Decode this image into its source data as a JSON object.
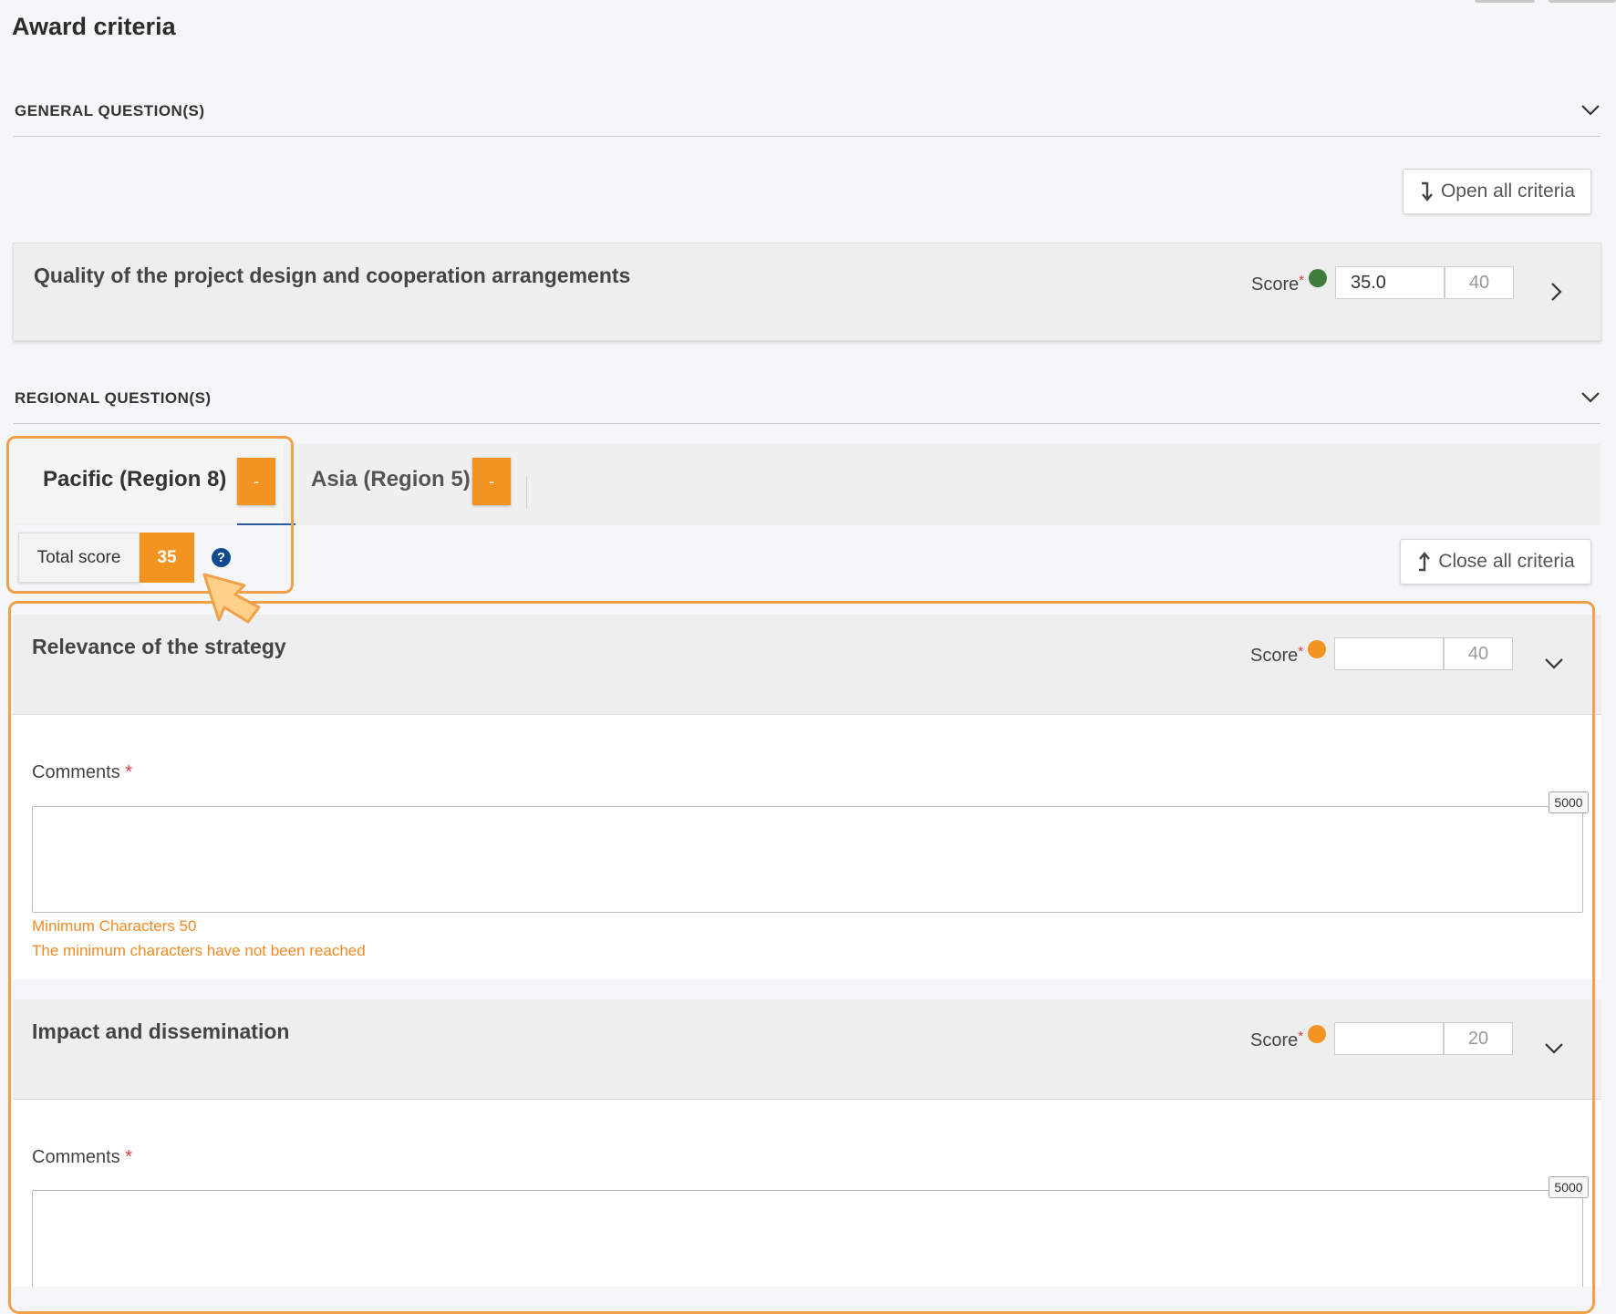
{
  "page": {
    "title": "Award criteria"
  },
  "general": {
    "header": "GENERAL QUESTION(S)",
    "open_all_label": "Open all criteria",
    "criterion": {
      "title": "Quality of the project design and cooperation arrangements",
      "score_label": "Score",
      "required_mark": "*",
      "score_value": "35.0",
      "max_score": "40",
      "status_color": "#3f7d3c"
    }
  },
  "regional": {
    "header": "REGIONAL QUESTION(S)",
    "tabs": [
      {
        "label": "Pacific (Region 8)",
        "badge": "-"
      },
      {
        "label": "Asia (Region 5)",
        "badge": "-"
      }
    ],
    "total_score_label": "Total score",
    "total_score_value": "35",
    "help_icon": "?",
    "close_all_label": "Close all criteria",
    "criteria": [
      {
        "title": "Relevance of the strategy",
        "score_label": "Score",
        "required_mark": "*",
        "score_value": "",
        "max_score": "40",
        "status_color": "#f39322",
        "comments_label": "Comments",
        "comments_required": "*",
        "char_limit": "5000",
        "min_chars": "Minimum Characters 50",
        "warning": "The minimum characters have not been reached"
      },
      {
        "title": "Impact and dissemination",
        "score_label": "Score",
        "required_mark": "*",
        "score_value": "",
        "max_score": "20",
        "status_color": "#f39322",
        "comments_label": "Comments",
        "comments_required": "*",
        "char_limit": "5000"
      }
    ]
  },
  "colors": {
    "accent": "#f39322",
    "highlight": "#f2a04a",
    "required": "#e03a3a",
    "help": "#124a8f"
  }
}
